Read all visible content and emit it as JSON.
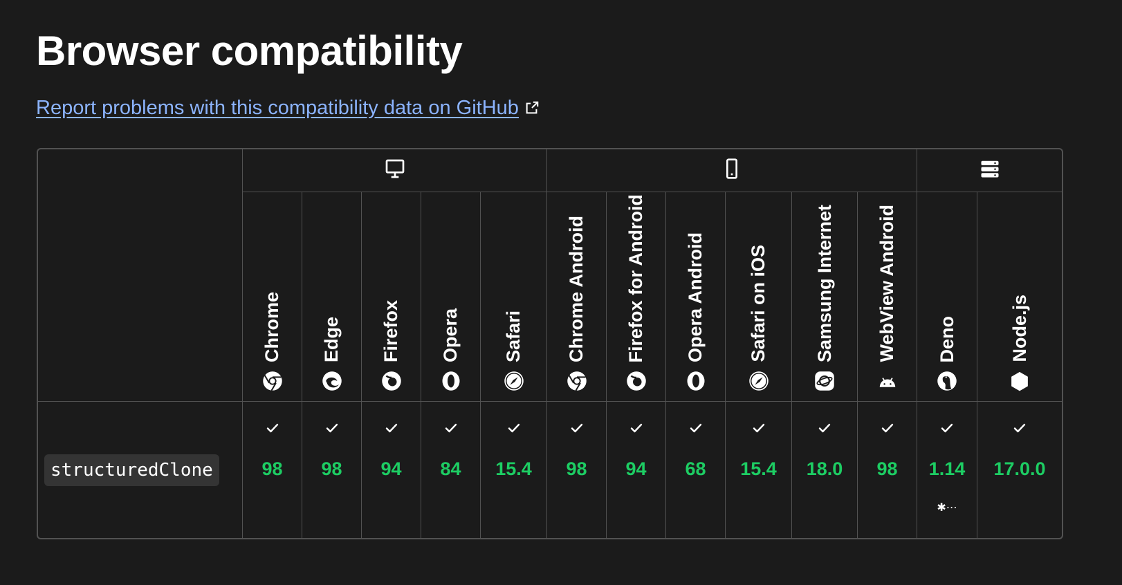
{
  "heading": "Browser compatibility",
  "report_link": "Report problems with this compatibility data on GitHub",
  "platforms": [
    {
      "icon": "desktop-icon",
      "span": 5
    },
    {
      "icon": "mobile-icon",
      "span": 6
    },
    {
      "icon": "server-icon",
      "span": 2
    }
  ],
  "browsers": [
    {
      "name": "Chrome",
      "icon": "chrome-icon"
    },
    {
      "name": "Edge",
      "icon": "edge-icon"
    },
    {
      "name": "Firefox",
      "icon": "firefox-icon"
    },
    {
      "name": "Opera",
      "icon": "opera-icon"
    },
    {
      "name": "Safari",
      "icon": "safari-icon"
    },
    {
      "name": "Chrome Android",
      "icon": "chrome-icon"
    },
    {
      "name": "Firefox for Android",
      "icon": "firefox-icon"
    },
    {
      "name": "Opera Android",
      "icon": "opera-icon"
    },
    {
      "name": "Safari on iOS",
      "icon": "safari-icon"
    },
    {
      "name": "Samsung Internet",
      "icon": "samsung-internet-icon"
    },
    {
      "name": "WebView Android",
      "icon": "android-icon"
    },
    {
      "name": "Deno",
      "icon": "deno-icon"
    },
    {
      "name": "Node.js",
      "icon": "nodejs-icon"
    }
  ],
  "feature": {
    "name": "structuredClone",
    "support": [
      {
        "version": "98",
        "status": "supported"
      },
      {
        "version": "98",
        "status": "supported"
      },
      {
        "version": "94",
        "status": "supported"
      },
      {
        "version": "84",
        "status": "supported"
      },
      {
        "version": "15.4",
        "status": "supported"
      },
      {
        "version": "98",
        "status": "supported"
      },
      {
        "version": "94",
        "status": "supported"
      },
      {
        "version": "68",
        "status": "supported"
      },
      {
        "version": "15.4",
        "status": "supported"
      },
      {
        "version": "18.0",
        "status": "supported"
      },
      {
        "version": "98",
        "status": "supported"
      },
      {
        "version": "1.14",
        "status": "supported",
        "notes": "✱⋯"
      },
      {
        "version": "17.0.0",
        "status": "supported"
      }
    ]
  },
  "colors": {
    "background": "#1b1b1b",
    "link": "#8cb4ff",
    "supported": "#1dcd63",
    "border": "#525252"
  }
}
